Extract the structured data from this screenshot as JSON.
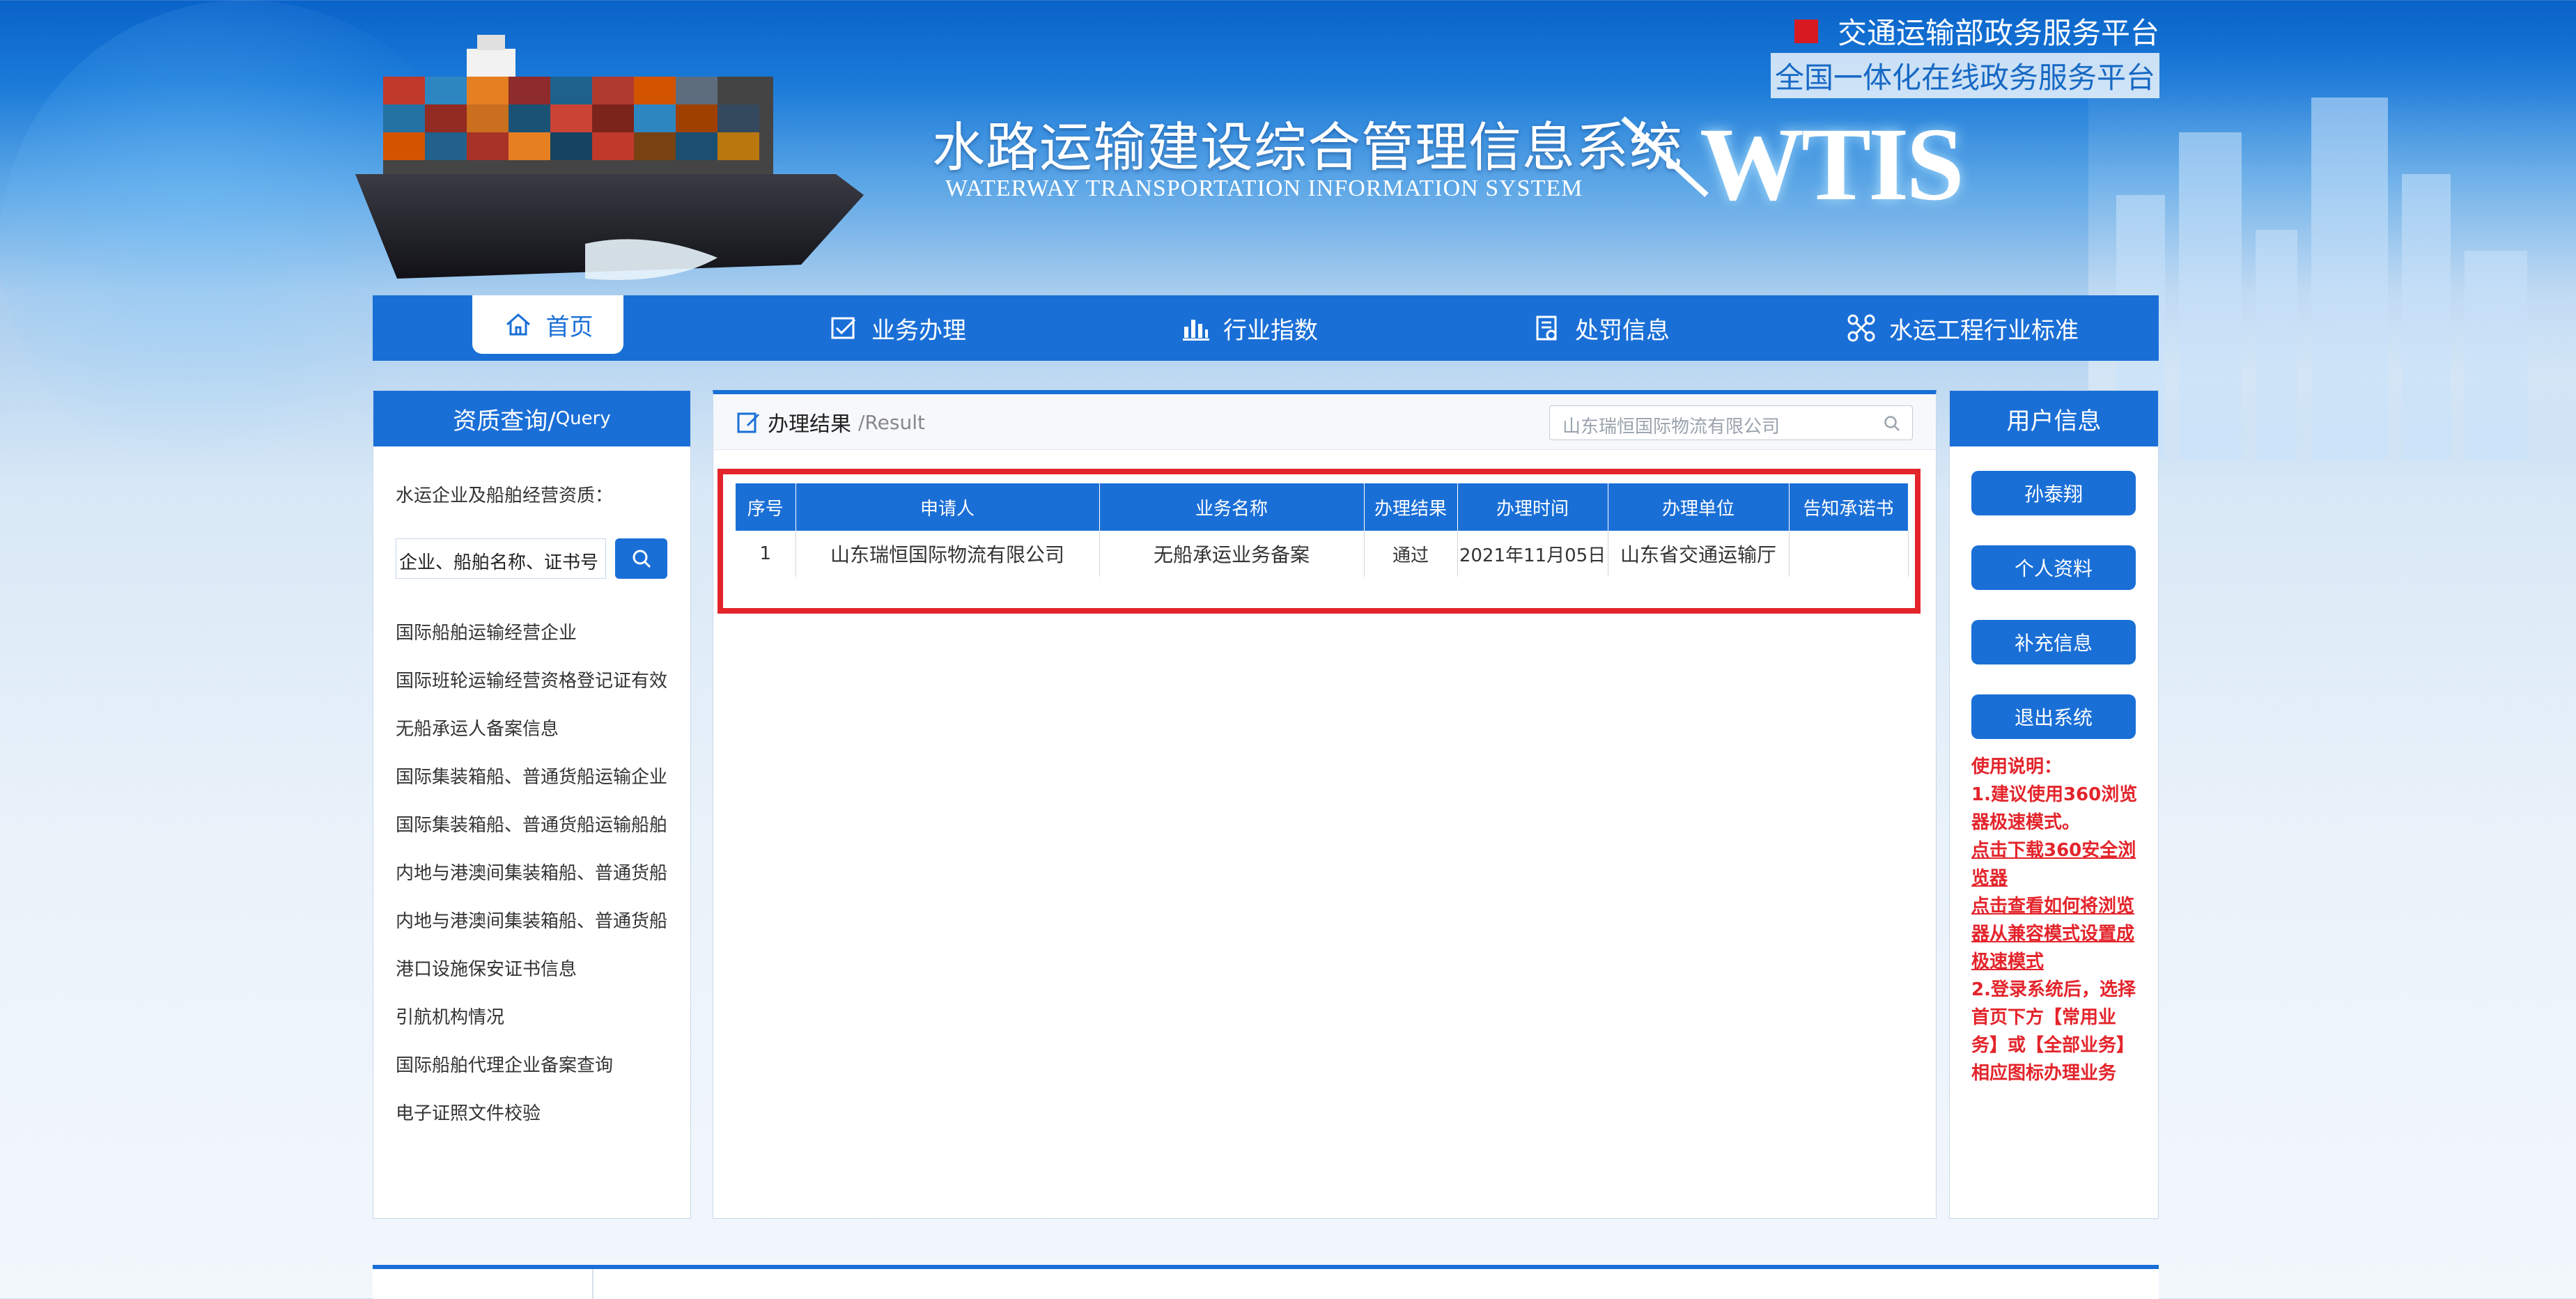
{
  "top_links": {
    "link1": "交通运输部政务服务平台",
    "link2": "全国一体化在线政务服务平台"
  },
  "header": {
    "title": "水路运输建设综合管理信息系统",
    "subtitle": "WATERWAY TRANSPORTATION INFORMATION SYSTEM",
    "logo_text": "WTIS"
  },
  "nav": {
    "items": [
      {
        "label": "首页",
        "icon": "home-icon"
      },
      {
        "label": "业务办理",
        "icon": "checkbox-icon"
      },
      {
        "label": "行业指数",
        "icon": "bar-chart-icon"
      },
      {
        "label": "处罚信息",
        "icon": "document-icon"
      },
      {
        "label": "水运工程行业标准",
        "icon": "network-icon"
      }
    ]
  },
  "left_panel": {
    "title": "资质查询/",
    "title_en": "Query",
    "intro": "水运企业及船舶经营资质：",
    "search_placeholder": "企业、船舶名称、证书号（",
    "links": [
      "国际船舶运输经营企业",
      "国际班轮运输经营资格登记证有效",
      "无船承运人备案信息",
      "国际集装箱船、普通货船运输企业",
      "国际集装箱船、普通货船运输船舶",
      "内地与港澳间集装箱船、普通货船",
      "内地与港澳间集装箱船、普通货船",
      "港口设施保安证书信息",
      "引航机构情况",
      "国际船舶代理企业备案查询",
      "电子证照文件校验"
    ]
  },
  "center_panel": {
    "title": "办理结果",
    "title_en": "/Result",
    "search_value": "山东瑞恒国际物流有限公司",
    "table": {
      "headers": [
        "序号",
        "申请人",
        "业务名称",
        "办理结果",
        "办理时间",
        "办理单位",
        "告知承诺书"
      ],
      "rows": [
        [
          "1",
          "山东瑞恒国际物流有限公司",
          "无船承运业务备案",
          "通过",
          "2021年11月05日",
          "山东省交通运输厅",
          ""
        ]
      ]
    }
  },
  "right_panel": {
    "title": "用户信息",
    "buttons": [
      "孙泰翔",
      "个人资料",
      "补充信息",
      "退出系统"
    ],
    "notes": {
      "heading": "使用说明：",
      "line1": "1.建议使用360浏览器极速模式。",
      "link1": "点击下载360安全浏览器",
      "link2": "点击查看如何将浏览器从兼容模式设置成极速模式",
      "line2": "2.登录系统后，选择首页下方【常用业务】或【全部业务】相应图标办理业务"
    }
  },
  "colors": {
    "primary": "#1a6fd7",
    "highlight": "#e3242b"
  }
}
